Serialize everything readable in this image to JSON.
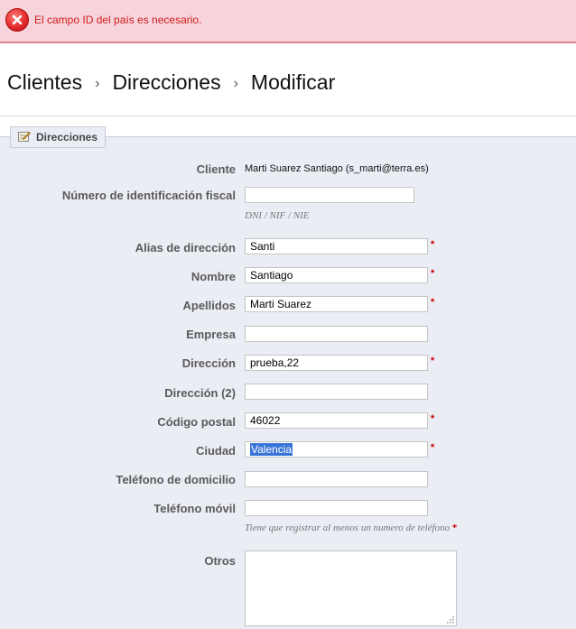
{
  "error": {
    "message": "El campo ID del país es necesario.",
    "icon": "error-x-icon",
    "color": "#d21a1a"
  },
  "breadcrumb": {
    "items": [
      "Clientes",
      "Direcciones",
      "Modificar"
    ],
    "separator": "›"
  },
  "panel": {
    "title": "Direcciones",
    "icon": "edit-icon"
  },
  "form": {
    "cliente": {
      "label": "Cliente",
      "value": "Marti Suarez Santiago (s_marti@terra.es)"
    },
    "nif": {
      "label": "Número de identificación fiscal",
      "value": "",
      "hint": "DNI / NIF / NIE"
    },
    "alias": {
      "label": "Alias de dirección",
      "value": "Santi",
      "required": "*"
    },
    "nombre": {
      "label": "Nombre",
      "value": "Santiago",
      "required": "*"
    },
    "apellidos": {
      "label": "Apellidos",
      "value": "Marti Suarez",
      "required": "*"
    },
    "empresa": {
      "label": "Empresa",
      "value": ""
    },
    "direccion": {
      "label": "Dirección",
      "value": "prueba,22",
      "required": "*"
    },
    "direccion2": {
      "label": "Dirección (2)",
      "value": ""
    },
    "codigo_postal": {
      "label": "Código postal",
      "value": "46022",
      "required": "*"
    },
    "ciudad": {
      "label": "Ciudad",
      "value": "Valencia",
      "required": "*"
    },
    "telefono_domicilio": {
      "label": "Teléfono de domicilio",
      "value": ""
    },
    "telefono_movil": {
      "label": "Teléfono móvil",
      "value": "",
      "hint": "Tiene que registrar al menos un numero de teléfono",
      "hint_required": "*"
    },
    "otros": {
      "label": "Otros",
      "value": ""
    }
  }
}
